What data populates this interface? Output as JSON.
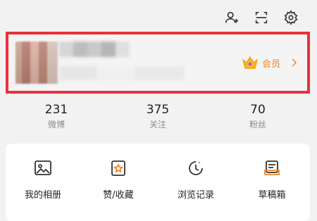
{
  "header": {
    "icons": [
      "add-user-icon",
      "scan-icon",
      "settings-icon"
    ]
  },
  "profile": {
    "member_label": "会员",
    "member_icon": "crown-icon",
    "accent_color": "#f0862b",
    "highlight_border_color": "#e8323c"
  },
  "stats": [
    {
      "value": "231",
      "label": "微博"
    },
    {
      "value": "375",
      "label": "关注"
    },
    {
      "value": "70",
      "label": "粉丝"
    }
  ],
  "tools": [
    {
      "label": "我的相册",
      "icon": "album-icon"
    },
    {
      "label": "赞/收藏",
      "icon": "likes-favorites-icon"
    },
    {
      "label": "浏览记录",
      "icon": "history-icon"
    },
    {
      "label": "草稿箱",
      "icon": "drafts-icon"
    }
  ]
}
